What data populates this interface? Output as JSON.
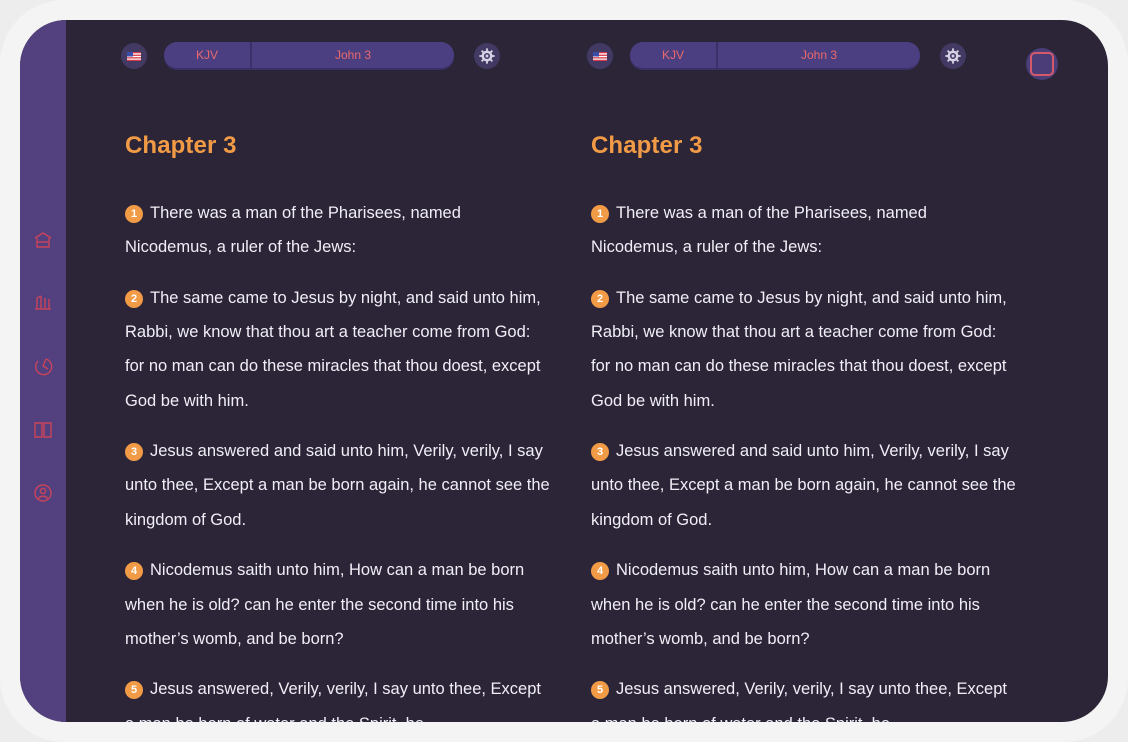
{
  "colors": {
    "background": "#2b2537",
    "rail": "#53407f",
    "accent_orange": "#f29b46",
    "accent_red": "#e9696b",
    "pill": "#4b3f82",
    "text": "#f1eef7"
  },
  "sidebar": {
    "items": [
      {
        "icon": "home-icon"
      },
      {
        "icon": "library-icon"
      },
      {
        "icon": "history-icon"
      },
      {
        "icon": "book-icon"
      },
      {
        "icon": "profile-icon"
      }
    ]
  },
  "panes": [
    {
      "language_icon": "us-flag-icon",
      "version": "KJV",
      "book_chapter": "John 3",
      "settings_icon": "gear-icon",
      "chapter_title": "Chapter 3",
      "verses": [
        {
          "num": "1",
          "text": "There was a man of the Pharisees, named Nicodemus, a ruler of the Jews:"
        },
        {
          "num": "2",
          "text": "The same came to Jesus by night, and said unto him, Rabbi, we know that thou art a teacher come from God: for no man can do these miracles that thou doest, except God be with him."
        },
        {
          "num": "3",
          "text": "Jesus answered and said unto him, Verily, verily, I say unto thee, Except a man be born again, he cannot see the kingdom of God."
        },
        {
          "num": "4",
          "text": "Nicodemus saith unto him, How can a man be born when he is old? can he enter the second time into his mother’s womb, and be born?"
        },
        {
          "num": "5",
          "text": "Jesus answered, Verily, verily, I say unto thee, Except a man be born of water and the Spirit, he"
        }
      ]
    },
    {
      "language_icon": "us-flag-icon",
      "version": "KJV",
      "book_chapter": "John 3",
      "settings_icon": "gear-icon",
      "chapter_title": "Chapter 3",
      "verses": [
        {
          "num": "1",
          "text": "There was a man of the Pharisees, named Nicodemus, a ruler of the Jews:"
        },
        {
          "num": "2",
          "text": "The same came to Jesus by night, and said unto him, Rabbi, we know that thou art a teacher come from God: for no man can do these miracles that thou doest, except God be with him."
        },
        {
          "num": "3",
          "text": "Jesus answered and said unto him, Verily, verily, I say unto thee, Except a man be born again, he cannot see the kingdom of God."
        },
        {
          "num": "4",
          "text": "Nicodemus saith unto him, How can a man be born when he is old? can he enter the second time into his mother’s womb, and be born?"
        },
        {
          "num": "5",
          "text": "Jesus answered, Verily, verily, I say unto thee, Except a man be born of water and the Spirit, he"
        }
      ]
    }
  ],
  "corner_button": {
    "icon": "split-view-icon"
  }
}
